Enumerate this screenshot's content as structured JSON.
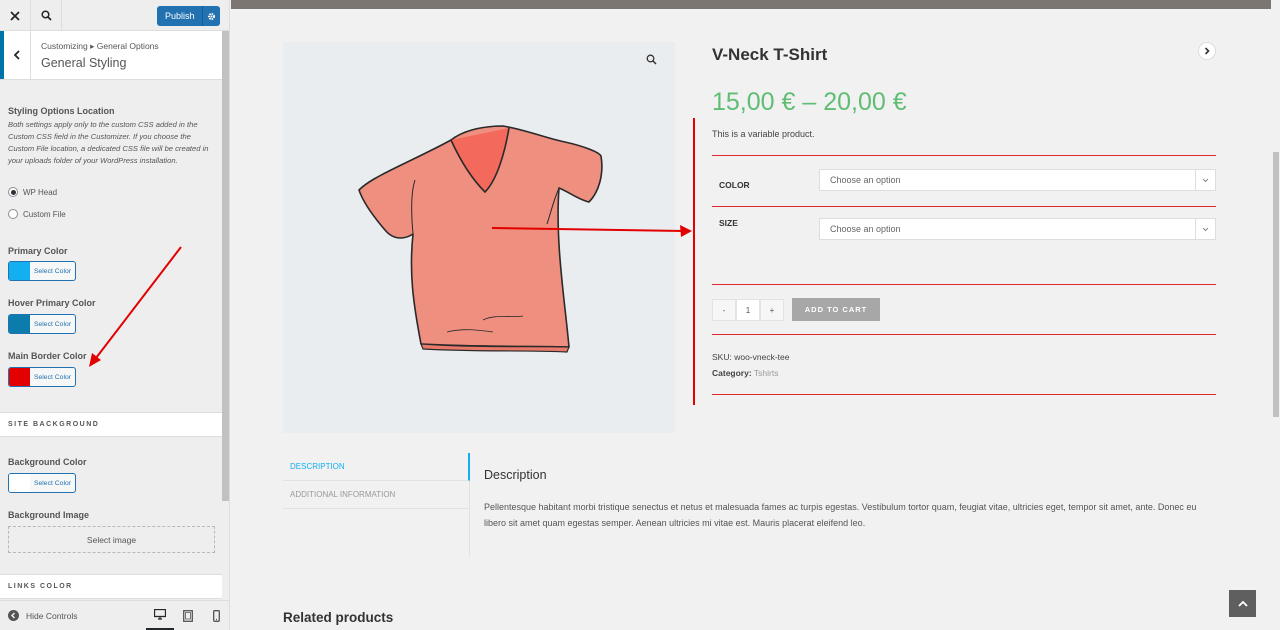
{
  "customizer": {
    "publish_label": "Publish",
    "breadcrumb": "Customizing ▸ General Options",
    "section_title": "General Styling",
    "styling_location": {
      "label": "Styling Options Location",
      "description": "Both settings apply only to the custom CSS added in the Custom CSS field in the Customizer. If you choose the Custom File location, a dedicated CSS file will be created in your uploads folder of your WordPress installation.",
      "options": [
        "WP Head",
        "Custom File"
      ],
      "selected": "WP Head"
    },
    "primary_color": {
      "label": "Primary Color",
      "button": "Select Color",
      "swatch": "#13aff0"
    },
    "hover_primary_color": {
      "label": "Hover Primary Color",
      "button": "Select Color",
      "swatch": "#0b7cac"
    },
    "main_border_color": {
      "label": "Main Border Color",
      "button": "Select Color",
      "swatch": "#e20000"
    },
    "site_background_heading": "SITE BACKGROUND",
    "background_color": {
      "label": "Background Color",
      "button": "Select Color",
      "swatch": "#ffffff"
    },
    "background_image": {
      "label": "Background Image",
      "button": "Select image"
    },
    "links_color_heading": "LINKS COLOR",
    "hide_controls": "Hide Controls"
  },
  "product": {
    "title": "V-Neck T-Shirt",
    "price": "15,00 € – 20,00 €",
    "short_description": "This is a variable product.",
    "attributes": [
      {
        "label": "COLOR",
        "placeholder": "Choose an option"
      },
      {
        "label": "SIZE",
        "placeholder": "Choose an option"
      }
    ],
    "qty_minus": "-",
    "qty": "1",
    "qty_plus": "+",
    "add_to_cart": "ADD TO CART",
    "sku_label": "SKU:",
    "sku": "woo-vneck-tee",
    "category_label": "Category:",
    "category": "Tshirts",
    "tabs": [
      "DESCRIPTION",
      "ADDITIONAL INFORMATION"
    ],
    "description_heading": "Description",
    "description_text": "Pellentesque habitant morbi tristique senectus et netus et malesuada fames ac turpis egestas. Vestibulum tortor quam, feugiat vitae, ultricies eget, tempor sit amet, ante. Donec eu libero sit amet quam egestas semper. Aenean ultricies mi vitae est. Mauris placerat eleifend leo.",
    "related_heading": "Related products"
  },
  "colors": {
    "accent": "#13aff0",
    "price": "#5fbd74",
    "border": "#e20000",
    "publish": "#2271b1"
  },
  "icons": [
    "close-icon",
    "search-icon",
    "gear-icon",
    "chevron-left-icon",
    "desktop-icon",
    "tablet-icon",
    "mobile-icon",
    "zoom-icon",
    "chevron-right-icon",
    "chevron-down-icon",
    "arrow-up-icon",
    "collapse-icon"
  ]
}
